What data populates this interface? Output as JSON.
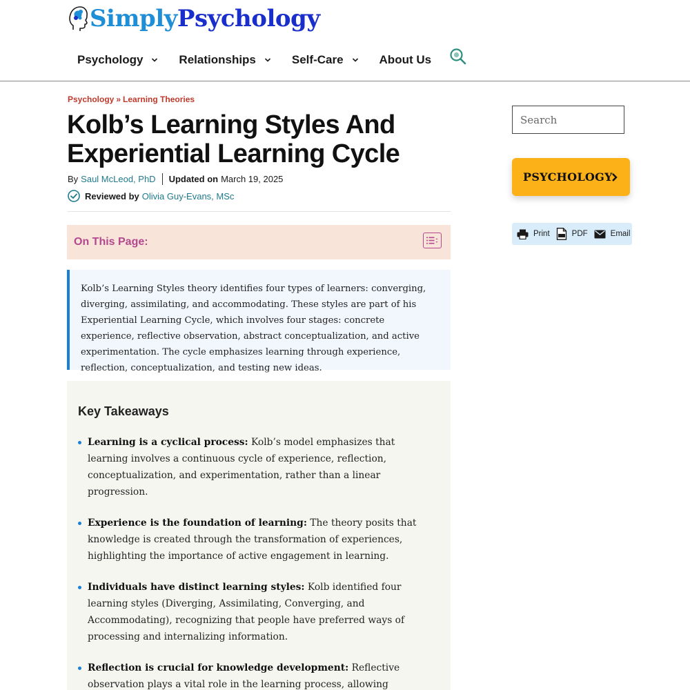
{
  "site": {
    "logo_simply": "Simply",
    "logo_psychology": "Psychology"
  },
  "nav": {
    "items": [
      {
        "label": "Psychology",
        "has_dropdown": true
      },
      {
        "label": "Relationships",
        "has_dropdown": true
      },
      {
        "label": "Self-Care",
        "has_dropdown": true
      },
      {
        "label": "About Us",
        "has_dropdown": false
      }
    ]
  },
  "breadcrumb": {
    "root": "Psychology",
    "separator": "»",
    "current": "Learning Theories"
  },
  "article": {
    "title": "Kolb’s Learning Styles And Experiential Learning Cycle",
    "by_label": "By",
    "author": "Saul McLeod, PhD",
    "updated_label": "Updated on",
    "updated_date": "March 19, 2025",
    "reviewed_label": "Reviewed by",
    "reviewer": "Olivia Guy-Evans, MSc"
  },
  "toc": {
    "title": "On This Page:"
  },
  "summary": {
    "text": "Kolb’s Learning Styles theory identifies four types of learners: converging, diverging, assimilating, and accommodating. These styles are part of his Experiential Learning Cycle, which involves four stages: concrete experience, reflective observation, abstract conceptualization, and active experimentation. The cycle emphasizes learning through experience, reflection, conceptualization, and testing new ideas."
  },
  "takeaways": {
    "heading": "Key Takeaways",
    "items": [
      {
        "lead": "Learning is a cyclical process:",
        "text": " Kolb’s model emphasizes that learning involves a continuous cycle of experience, reflection, conceptualization, and experimentation, rather than a linear progression."
      },
      {
        "lead": "Experience is the foundation of learning:",
        "text": " The theory posits that knowledge is created through the transformation of experiences, highlighting the importance of active engagement in learning."
      },
      {
        "lead": "Individuals have distinct learning styles:",
        "text": " Kolb identified four learning styles (Diverging, Assimilating, Converging, and Accommodating), recognizing that people have preferred ways of processing and internalizing information."
      },
      {
        "lead": "Reflection is crucial for knowledge development:",
        "text": " Reflective observation plays a vital role in the learning process, allowing individuals to analyze and make sense of their experiences."
      }
    ]
  },
  "sidebar": {
    "search_placeholder": "Search",
    "category_button": "PSYCHOLOGY",
    "print_label": "Print",
    "pdf_label": "PDF",
    "email_label": "Email"
  },
  "colors": {
    "brand_light_blue": "#1e8fd6",
    "brand_dark_blue": "#1a2ecb",
    "breadcrumb_red": "#c0392b",
    "link_teal": "#1f7a8c",
    "toc_bg": "#f9e4d9",
    "toc_text": "#b4488f",
    "summary_bg": "#f2f6fd",
    "summary_border": "#1a7fd6",
    "takeaways_bg": "#f6f6f1",
    "cta_yellow": "#fbb117",
    "pfe_bg": "#d9ecfa"
  }
}
